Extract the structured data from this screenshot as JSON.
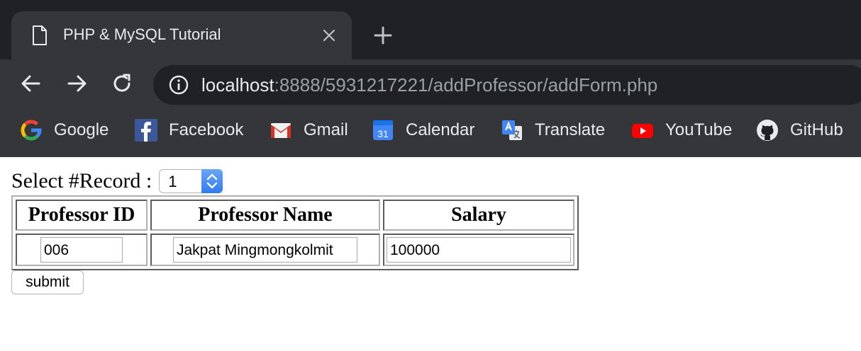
{
  "browser": {
    "tab_title": "PHP & MySQL Tutorial",
    "url_host": "localhost",
    "url_rest": ":8888/5931217221/addProfessor/addForm.php",
    "bookmarks": [
      {
        "label": "Google",
        "icon": "google-icon"
      },
      {
        "label": "Facebook",
        "icon": "facebook-icon"
      },
      {
        "label": "Gmail",
        "icon": "gmail-icon"
      },
      {
        "label": "Calendar",
        "icon": "calendar-icon",
        "icon_text": "31"
      },
      {
        "label": "Translate",
        "icon": "translate-icon"
      },
      {
        "label": "YouTube",
        "icon": "youtube-icon"
      },
      {
        "label": "GitHub",
        "icon": "github-icon"
      }
    ]
  },
  "form": {
    "record_label": "Select #Record :",
    "record_value": "1",
    "columns": [
      "Professor ID",
      "Professor Name",
      "Salary"
    ],
    "row": {
      "professor_id": "006",
      "professor_name": "Jakpat Mingmongkolmit",
      "salary": "100000"
    },
    "submit_label": "submit"
  },
  "colors": {
    "chrome_dark": "#202124",
    "chrome_toolbar": "#35363a",
    "text_light": "#e8eaed",
    "text_muted": "#9aa0a6",
    "select_accent": "#2f7cf2"
  }
}
